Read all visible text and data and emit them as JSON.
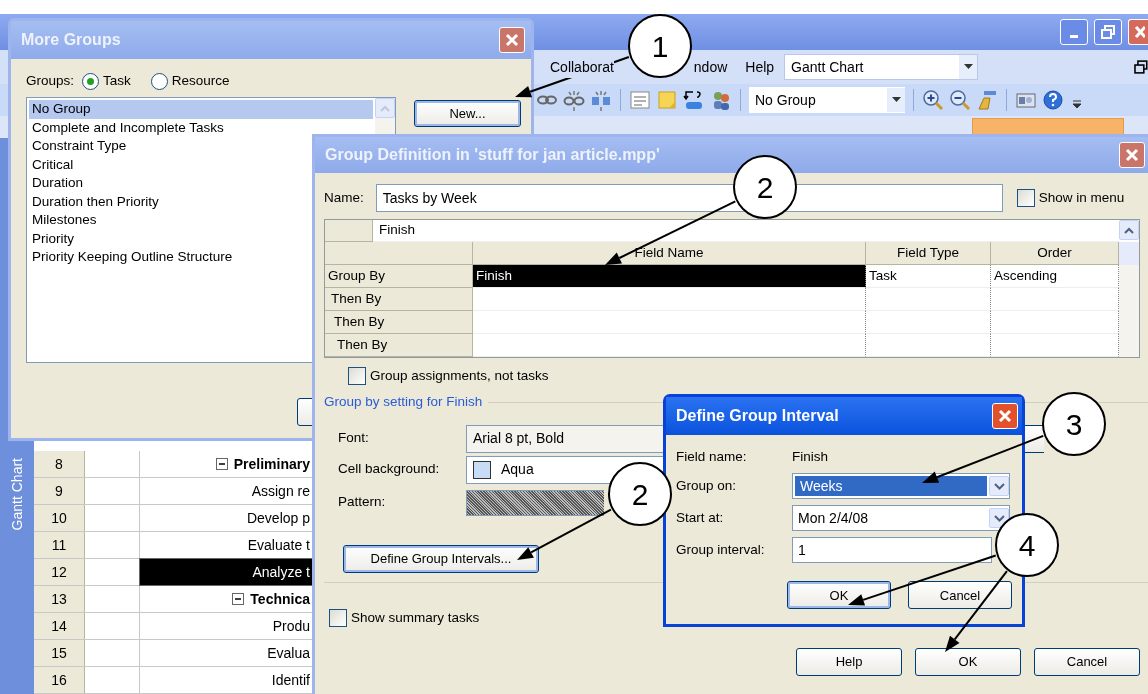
{
  "app": {
    "menu": [
      {
        "label": "Collaborat"
      },
      {
        "label": "ndow"
      },
      {
        "label": "Help"
      }
    ],
    "view_combo": "Gantt Chart",
    "group_combo": "No Group",
    "view_bar_label": "Gantt Chart",
    "tasks": [
      {
        "number": "8",
        "name": "Preliminary",
        "kind": "summary",
        "selected": false
      },
      {
        "number": "9",
        "name": "Assign re",
        "kind": "task",
        "selected": false
      },
      {
        "number": "10",
        "name": "Develop p",
        "kind": "task",
        "selected": false
      },
      {
        "number": "11",
        "name": "Evaluate t",
        "kind": "task",
        "selected": false
      },
      {
        "number": "12",
        "name": "Analyze t",
        "kind": "task",
        "selected": true
      },
      {
        "number": "13",
        "name": "Technica",
        "kind": "summary",
        "selected": false
      },
      {
        "number": "14",
        "name": "Produ",
        "kind": "task",
        "selected": false
      },
      {
        "number": "15",
        "name": "Evalua",
        "kind": "task",
        "selected": false
      },
      {
        "number": "16",
        "name": "Identif",
        "kind": "task",
        "selected": false
      }
    ]
  },
  "more_groups": {
    "title": "More Groups",
    "groups_label": "Groups:",
    "group_types": [
      {
        "label": "Task",
        "selected": true
      },
      {
        "label": "Resource",
        "selected": false
      }
    ],
    "groups": [
      {
        "label": "No Group",
        "selected": true
      },
      {
        "label": "Complete and Incomplete Tasks",
        "selected": false
      },
      {
        "label": "Constraint Type",
        "selected": false
      },
      {
        "label": "Critical",
        "selected": false
      },
      {
        "label": "Duration",
        "selected": false
      },
      {
        "label": "Duration then Priority",
        "selected": false
      },
      {
        "label": "Milestones",
        "selected": false
      },
      {
        "label": "Priority",
        "selected": false
      },
      {
        "label": "Priority Keeping Outline Structure",
        "selected": false
      }
    ],
    "new_button": "New..."
  },
  "group_definition": {
    "title": "Group Definition in 'stuff for jan article.mpp'",
    "name_label": "Name:",
    "name_value": "Tasks by Week",
    "show_in_menu": {
      "label": "Show in menu",
      "checked": false
    },
    "edit_value": "Finish",
    "columns": [
      "Field Name",
      "Field Type",
      "Order"
    ],
    "rows": [
      {
        "label": "Group By",
        "field_name": "Finish",
        "field_type": "Task",
        "order": "Ascending",
        "selected": true
      },
      {
        "label": "Then By",
        "selected": false
      },
      {
        "label": "Then By",
        "selected": false
      },
      {
        "label": "Then By",
        "selected": false
      }
    ],
    "group_assignments": {
      "label": "Group assignments, not tasks",
      "checked": false
    },
    "settings_title": "Group by setting for Finish",
    "font_label": "Font:",
    "font_value": "Arial 8 pt, Bold",
    "cell_background_label": "Cell background:",
    "cell_background_value": "Aqua",
    "pattern_label": "Pattern:",
    "intervals_button": "Define Group Intervals...",
    "show_summary": {
      "label": "Show summary tasks",
      "checked": false
    },
    "buttons": [
      "Help",
      "OK",
      "Cancel"
    ]
  },
  "define_group_interval": {
    "title": "Define Group Interval",
    "field_name_label": "Field name:",
    "field_name_value": "Finish",
    "group_on_label": "Group on:",
    "group_on_value": "Weeks",
    "start_at_label": "Start at:",
    "start_at_value": "Mon 2/4/08",
    "interval_label": "Group interval:",
    "interval_value": "1",
    "buttons": [
      "OK",
      "Cancel"
    ]
  },
  "callouts": [
    {
      "number": "1"
    },
    {
      "number": "2"
    },
    {
      "number": "2"
    },
    {
      "number": "3"
    },
    {
      "number": "4"
    }
  ]
}
